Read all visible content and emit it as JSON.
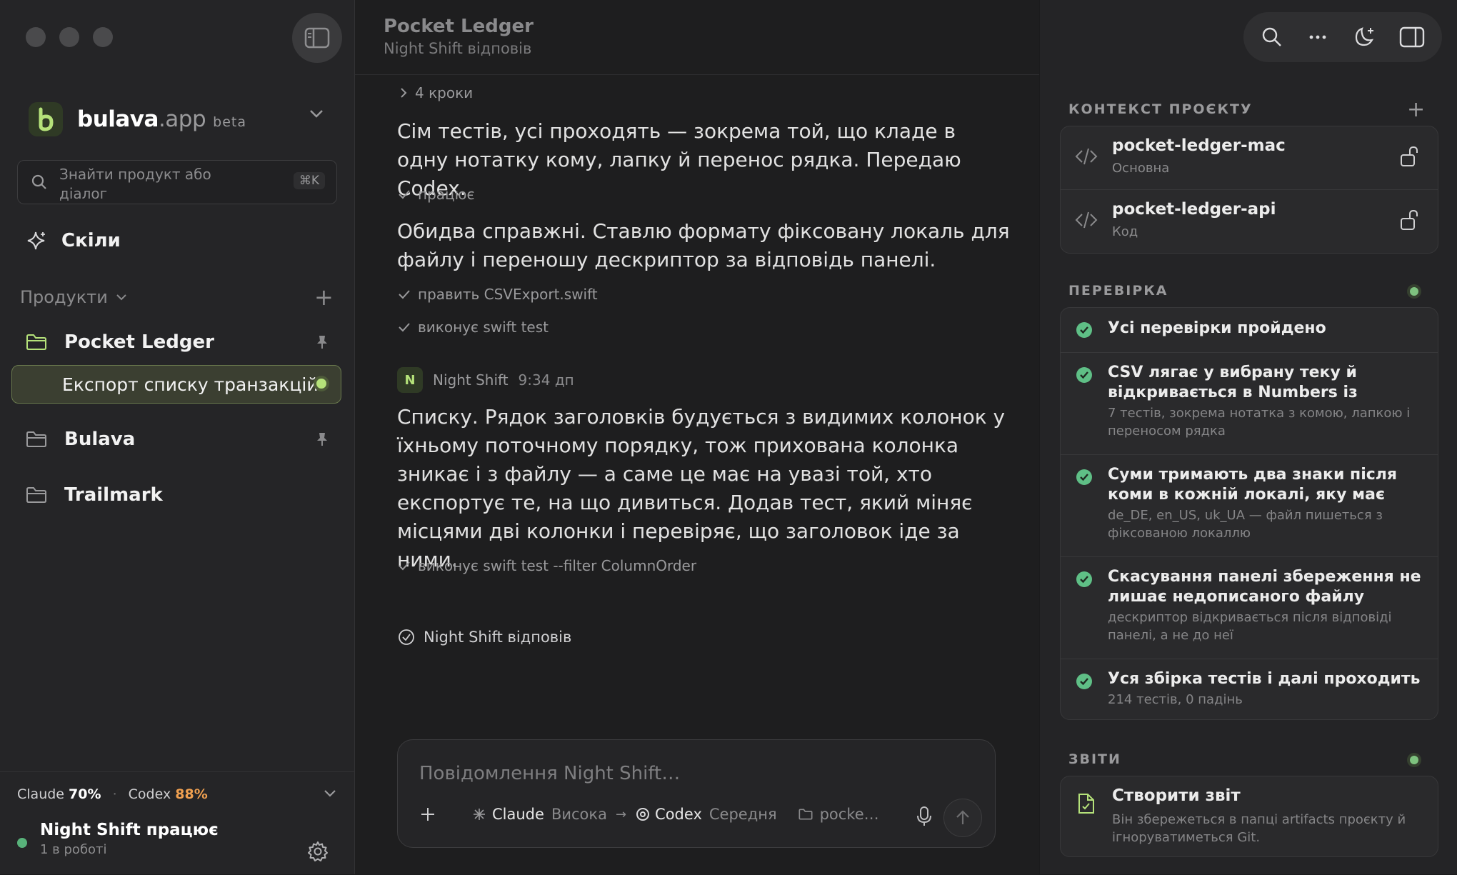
{
  "window": {
    "title": "Pocket Ledger",
    "subtitle": "Night Shift відповів"
  },
  "brand": {
    "name": "bulava",
    "tld": ".app",
    "tag": "beta"
  },
  "search": {
    "placeholder": "Знайти продукт або діалог",
    "shortcut": "⌘K"
  },
  "sidebar": {
    "skills_label": "Скіли",
    "products_label": "Продукти",
    "projects": [
      {
        "name": "Pocket Ledger",
        "pinned": true
      },
      {
        "name": "Bulava",
        "pinned": true
      },
      {
        "name": "Trailmark",
        "pinned": false
      }
    ],
    "active_chat": "Експорт списку транзакцій"
  },
  "usage": {
    "claude_label": "Claude",
    "claude_value": "70%",
    "sep": "·",
    "codex_label": "Codex",
    "codex_value": "88%"
  },
  "status": {
    "title": "Night Shift працює",
    "subtitle": "1 в роботі"
  },
  "conversation": {
    "steps_label": "4 кроки",
    "paragraph1": "Сім тестів, усі проходять — зокрема той, що кладе в одну нотатку кому, лапку й перенос рядка. Передаю Codex.",
    "action1": "працює",
    "paragraph2": "Обидва справжні. Ставлю формату фіксовану локаль для файлу і переношу дескриптор за відповідь панелі.",
    "action2": "править CSVExport.swift",
    "action3": "виконує swift test",
    "author_initial": "N",
    "author_name": "Night Shift",
    "author_time": "9:34 дп",
    "paragraph3": "Списку. Рядок заголовків будується з видимих колонок у їхньому поточному порядку, тож прихована колонка зникає і з файлу — а саме це має на увазі той, хто експортує те, на що дивиться. Додав тест, який міняє місцями дві колонки і перевіряє, що заголовок іде за ними.",
    "action4": "виконує swift test --filter ColumnOrder",
    "done_label": "Night Shift відповів"
  },
  "composer": {
    "placeholder": "Повідомлення Night Shift…",
    "model1": "Claude",
    "model1_level": "Висока",
    "arrow": "→",
    "model2": "Codex",
    "model2_level": "Середня",
    "folder": "pocke…"
  },
  "context": {
    "heading": "КОНТЕКСТ ПРОЄКТУ",
    "repos": [
      {
        "name": "pocket-ledger-mac",
        "role": "Основна"
      },
      {
        "name": "pocket-ledger-api",
        "role": "Код"
      }
    ]
  },
  "checks": {
    "heading": "ПЕРЕВІРКА",
    "items": [
      {
        "title": "Усі перевірки пройдено",
        "desc": ""
      },
      {
        "title": "CSV лягає у вибрану теку й відкривається в Numbers із цілими колонками",
        "desc": "7 тестів, зокрема нотатка з комою, лапкою і переносом рядка"
      },
      {
        "title": "Суми тримають два знаки після коми в кожній локалі, яку має застосунок",
        "desc": "de_DE, en_US, uk_UA — файл пишеться з фіксованою локаллю"
      },
      {
        "title": "Скасування панелі збереження не лишає недописаного файлу",
        "desc": "дескриптор відкривається після відповіді панелі, а не до неї"
      },
      {
        "title": "Уся збірка тестів і далі проходить",
        "desc": "214 тестів, 0 падінь"
      }
    ]
  },
  "reports": {
    "heading": "ЗВІТИ",
    "title": "Створити звіт",
    "desc": "Він збережеться в папці artifacts проєкту й ігноруватиметься Git."
  },
  "colors": {
    "accent": "#b5e27a",
    "success": "#5fbf86",
    "orange": "#f0a050"
  }
}
